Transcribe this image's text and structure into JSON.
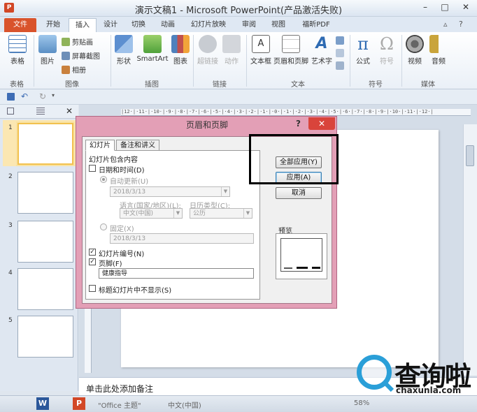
{
  "window": {
    "title": "演示文稿1 - Microsoft PowerPoint(产品激活失败)",
    "app_icon": "P",
    "min": "–",
    "max": "□",
    "close": "✕"
  },
  "tabs": [
    "文件",
    "开始",
    "插入",
    "设计",
    "切换",
    "动画",
    "幻灯片放映",
    "审阅",
    "视图",
    "福昕PDF"
  ],
  "active_tab": "插入",
  "ribbon": {
    "table": "表格",
    "picture": "图片",
    "clipart": "剪贴画",
    "screenshot": "屏幕截图",
    "album": "相册",
    "shapes": "形状",
    "smartart": "SmartArt",
    "chart": "图表",
    "hyperlink": "超链接",
    "action": "动作",
    "textbox": "文本框",
    "header_footer": "页眉和页脚",
    "wordart": "艺术字",
    "equation": "公式",
    "symbol": "符号",
    "video": "视频",
    "audio": "音频",
    "groups": {
      "tables": "表格",
      "images": "图像",
      "illustrations": "插图",
      "links": "链接",
      "text": "文本",
      "symbols": "符号",
      "media": "媒体"
    }
  },
  "slides_panel": {
    "numbers": [
      "1",
      "2",
      "3",
      "4",
      "5"
    ]
  },
  "ruler_text": "|12·|·11·|·10·|·9·|·8·|·7·|·6·|·5·|·4·|·3·|·2·|·1·|·0·|·1·|·2·|·3·|·4·|·5·|·6·|·7·|·8·|·9·|·10·|·11·|·12·|",
  "notes_placeholder": "单击此处添加备注",
  "status": {
    "theme": "\"Office 主题\"",
    "language": "中文(中国)",
    "zoom": "58%"
  },
  "dialog": {
    "title": "页眉和页脚",
    "help": "?",
    "close": "✕",
    "tab_slide": "幻灯片",
    "tab_notes": "备注和讲义",
    "section": "幻灯片包含内容",
    "datetime": "日期和时间(D)",
    "auto_update": "自动更新(U)",
    "auto_date": "2018/3/13",
    "language_label": "语言(国家/地区)(L):",
    "calendar_label": "日历类型(C):",
    "language_value": "中文(中国)",
    "calendar_value": "公历",
    "fixed": "固定(X)",
    "fixed_date": "2018/3/13",
    "slide_number": "幻灯片编号(N)",
    "footer": "页脚(F)",
    "footer_text": "健康指导",
    "hide_title": "标题幻灯片中不显示(S)",
    "apply_all": "全部应用(Y)",
    "apply": "应用(A)",
    "cancel": "取消",
    "preview": "预览"
  },
  "watermark": {
    "text": "查询啦",
    "url": "chaxunla.com"
  }
}
